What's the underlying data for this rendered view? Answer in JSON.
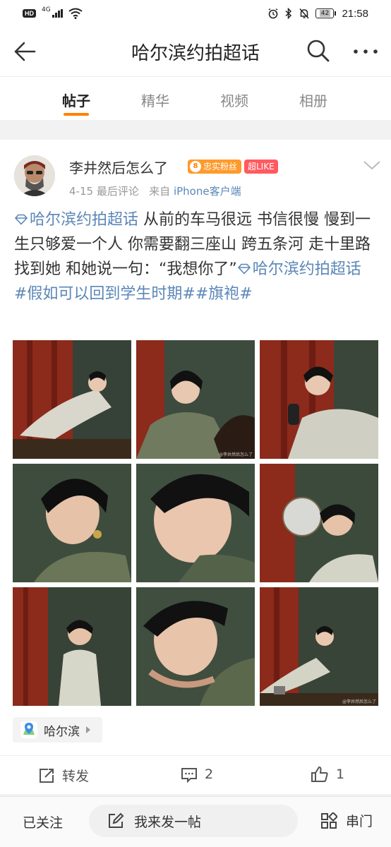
{
  "status_bar": {
    "hd": "HD",
    "network": "4G",
    "battery": "42",
    "time": "21:58"
  },
  "header": {
    "title": "哈尔滨约拍超话"
  },
  "tabs": [
    {
      "label": "帖子",
      "active": true
    },
    {
      "label": "精华",
      "active": false
    },
    {
      "label": "视频",
      "active": false
    },
    {
      "label": "相册",
      "active": false
    }
  ],
  "post": {
    "author": "李井然后怎么了",
    "fan_badge_level": "8",
    "fan_badge": "忠实粉丝",
    "like_badge": "超LIKE",
    "meta_date": "4-15",
    "meta_comment": "最后评论",
    "meta_from": "来自",
    "meta_source": "iPhone客户端",
    "topic1": "哈尔滨约拍超话",
    "text_main": " 从前的车马很远 书信很慢 慢到一生只够爱一个人 你需要翻三座山 跨五条河 走十里路 找到她 和她说一句：“我想你了”",
    "topic2": "哈尔滨约拍超话",
    "tags": " #假如可以回到学生时期##旗袍#",
    "watermark": "@李井然后怎么了",
    "location": "哈尔滨",
    "repost_label": "转发",
    "comment_count": "2",
    "like_count": "1"
  },
  "bottom_bar": {
    "follow": "已关注",
    "post_button": "我来发一帖",
    "series": "串门"
  },
  "colors": {
    "accent": "#ff8200",
    "link": "#5b87b7",
    "like_badge": "#ff5a5f"
  }
}
